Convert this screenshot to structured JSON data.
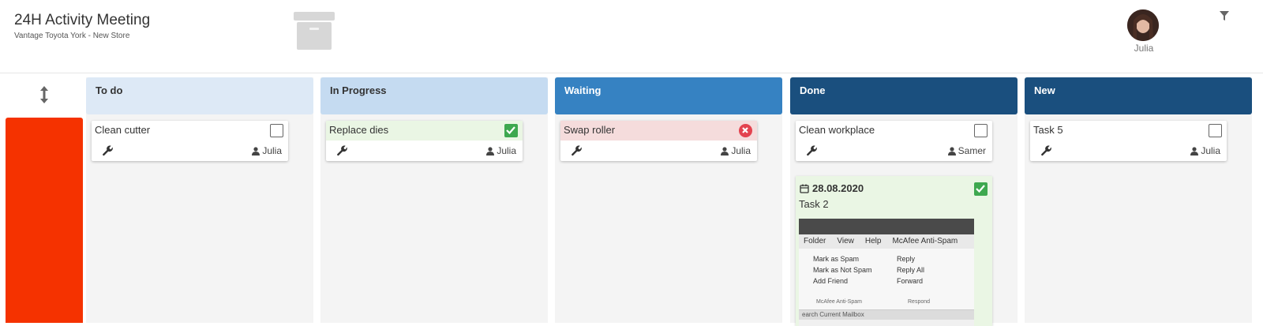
{
  "header": {
    "title": "24H Activity Meeting",
    "subtitle": "Vantage Toyota York - New Store",
    "user_name": "Julia"
  },
  "columns": [
    {
      "title": "To do",
      "color": "#dde9f6"
    },
    {
      "title": "In Progress",
      "color": "#c5dbf1"
    },
    {
      "title": "Waiting",
      "color": "#3682c2"
    },
    {
      "title": "Done",
      "color": "#1a4f7e"
    },
    {
      "title": "New",
      "color": "#1a4f7e"
    }
  ],
  "cards": [
    {
      "title": "Clean cutter",
      "user": "Julia",
      "status": "unchecked"
    },
    {
      "title": "Replace dies",
      "user": "Julia",
      "status": "done"
    },
    {
      "title": "Swap roller",
      "user": "Julia",
      "status": "rejected"
    },
    {
      "title": "Clean workplace",
      "user": "Samer",
      "status": "unchecked"
    },
    {
      "title": "Task 5",
      "user": "Julia",
      "status": "unchecked"
    }
  ],
  "done_card2": {
    "date": "28.08.2020",
    "title": "Task 2",
    "screenshot": {
      "menu": [
        "Folder",
        "View",
        "Help",
        "McAfee Anti-Spam"
      ],
      "ribbon_left": [
        "Mark as Spam",
        "Mark as Not Spam",
        "Add Friend"
      ],
      "ribbon_mid": [
        "Reply",
        "Reply All",
        "Forward"
      ],
      "group_left": "McAfee Anti-Spam",
      "group_mid": "Respond",
      "footer": "earch Current Mailbox"
    }
  },
  "colors": {
    "lane_marker": "#f53200",
    "check_green": "#3ea84f",
    "reject_red": "#e3434f"
  }
}
